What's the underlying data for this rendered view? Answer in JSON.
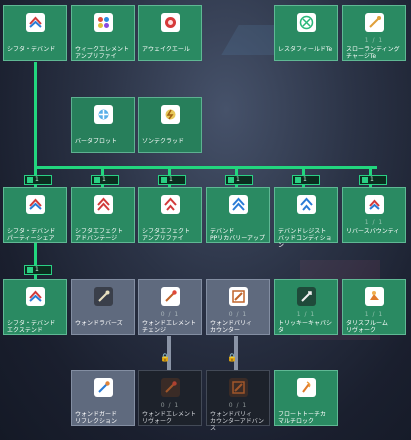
{
  "colors": {
    "learned": "#2a8a62",
    "available": "#5f6a7e",
    "locked": "#1d222b",
    "connector": "#22d67e"
  },
  "tier_badges": [
    {
      "label": "1"
    },
    {
      "label": "1"
    },
    {
      "label": "1"
    },
    {
      "label": "1"
    },
    {
      "label": "1"
    },
    {
      "label": "1"
    },
    {
      "label": "1"
    }
  ],
  "cards": [
    {
      "label": "シフタ・デバンド",
      "rank": "",
      "icon": "shifta-deband-icon",
      "state": "learned"
    },
    {
      "label": "ウィークエレメント\nアンプリファイ",
      "rank": "",
      "icon": "weak-element-icon",
      "state": "learned"
    },
    {
      "label": "アウェイクエール",
      "rank": "",
      "icon": "awake-aile-icon",
      "state": "learned"
    },
    {
      "label": "レスタフィールドTe",
      "rank": "",
      "icon": "resta-field-icon",
      "state": "learned"
    },
    {
      "label": "スローランディング\nチャージTe",
      "rank": "1 / 1",
      "icon": "slow-landing-icon",
      "state": "learned"
    },
    {
      "label": "バータブロット",
      "rank": "",
      "icon": "barta-blot-icon",
      "state": "learned"
    },
    {
      "label": "ゾンデクラッド",
      "rank": "",
      "icon": "zonde-clad-icon",
      "state": "learned"
    },
    {
      "label": "シフタ・デバンド\nパーティーシェア",
      "rank": "",
      "icon": "party-share-icon",
      "state": "learned"
    },
    {
      "label": "シフタエフェクト\nアドバンテージ",
      "rank": "",
      "icon": "shifta-advantage-icon",
      "state": "learned"
    },
    {
      "label": "シフタエフェクト\nアンプリファイ",
      "rank": "",
      "icon": "shifta-amplify-icon",
      "state": "learned"
    },
    {
      "label": "デバンド\nPPリカバリーアップ",
      "rank": "",
      "icon": "deband-pp-icon",
      "state": "learned"
    },
    {
      "label": "デバンドレジスト\nバッドコンディション",
      "rank": "",
      "icon": "deband-resist-icon",
      "state": "learned"
    },
    {
      "label": "リバースバウンティ",
      "rank": "1 / 1",
      "icon": "reverse-bounty-icon",
      "state": "learned"
    },
    {
      "label": "シフタ・デバンド\nエクステンド",
      "rank": "",
      "icon": "extend-icon",
      "state": "learned"
    },
    {
      "label": "ウォンドラバーズ",
      "rank": "",
      "icon": "wand-lovers-icon",
      "state": "available"
    },
    {
      "label": "ウォンドエレメント\nチェンジ",
      "rank": "0 / 1",
      "icon": "wand-element-change-icon",
      "state": "available"
    },
    {
      "label": "ウォンドパリィ\nカウンター",
      "rank": "0 / 1",
      "icon": "wand-parry-counter-icon",
      "state": "available"
    },
    {
      "label": "トリッキーキャパシタ",
      "rank": "1 / 1",
      "icon": "tricky-capacitor-icon",
      "state": "learned"
    },
    {
      "label": "タリスブルーム\nリヴォーク",
      "rank": "1 / 1",
      "icon": "talis-bloom-icon",
      "state": "learned"
    },
    {
      "label": "ウォンドガード\nリフレクション",
      "rank": "",
      "icon": "wand-guard-icon",
      "state": "available"
    },
    {
      "label": "ウォンドエレメント\nリヴォーク",
      "rank": "0 / 1",
      "icon": "wand-element-revoke-icon",
      "state": "locked"
    },
    {
      "label": "ウォンドパリィ\nカウンターアドバンス",
      "rank": "0 / 1",
      "icon": "wand-parry-advance-icon",
      "state": "locked"
    },
    {
      "label": "フロートトーチカ\nマルチロック",
      "rank": "",
      "icon": "float-torch-icon",
      "state": "learned"
    }
  ]
}
